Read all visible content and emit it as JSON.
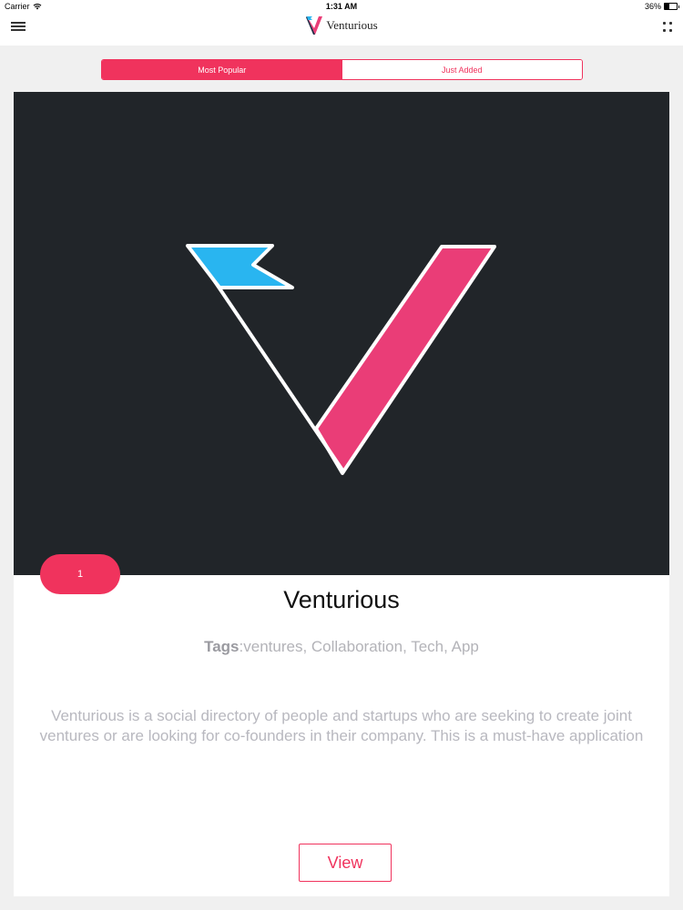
{
  "status_bar": {
    "carrier": "Carrier",
    "time": "1:31 AM",
    "battery": "36%"
  },
  "nav": {
    "brand": "Venturious"
  },
  "tabs": [
    {
      "label": "Most Popular",
      "active": true
    },
    {
      "label": "Just Added",
      "active": false
    }
  ],
  "card": {
    "rank": "1",
    "title": "Venturious",
    "tags_label": "Tags",
    "tags_separator": ":",
    "tags_value": "ventures, Collaboration, Tech, App",
    "description": "Venturious is a social directory of people and startups who are seeking to create joint ventures or are looking for co-founders in their company. This is a must-have application",
    "view_label": "View"
  },
  "colors": {
    "accent": "#f0335d",
    "hero_bg": "#212529",
    "flag_blue": "#29b5f0",
    "logo_pink": "#ea3d77"
  }
}
